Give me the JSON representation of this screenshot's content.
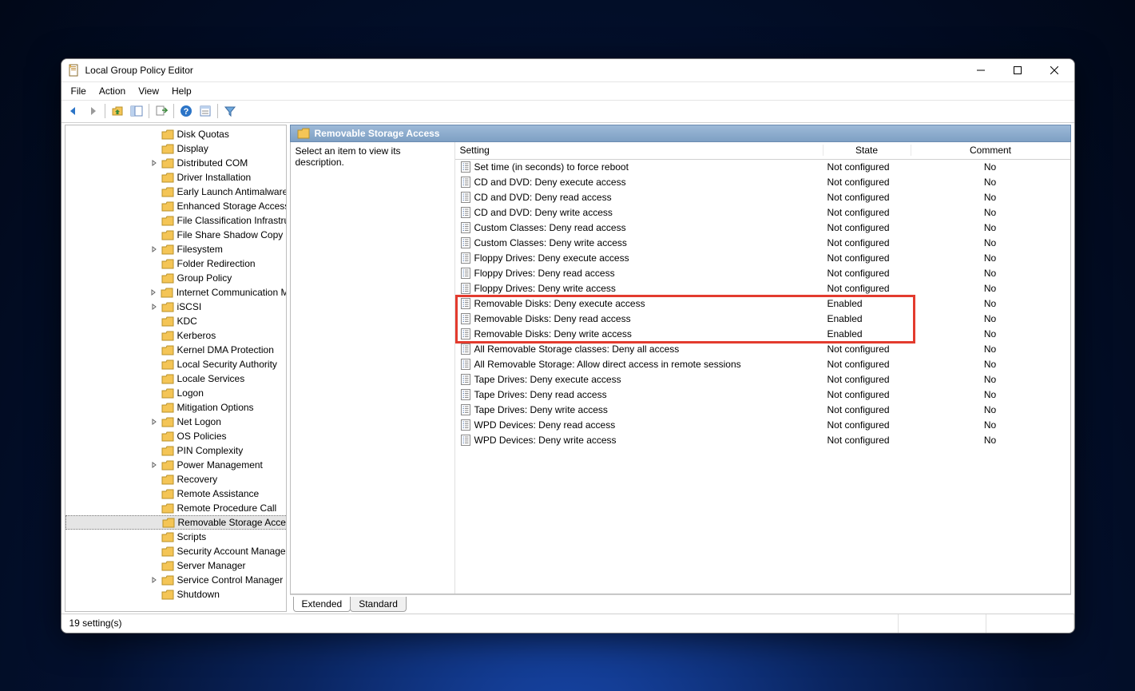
{
  "window": {
    "title": "Local Group Policy Editor"
  },
  "menubar": [
    "File",
    "Action",
    "View",
    "Help"
  ],
  "tree": [
    {
      "label": "Disk Quotas",
      "exp": ""
    },
    {
      "label": "Display",
      "exp": ""
    },
    {
      "label": "Distributed COM",
      "exp": ">"
    },
    {
      "label": "Driver Installation",
      "exp": ""
    },
    {
      "label": "Early Launch Antimalware",
      "exp": ""
    },
    {
      "label": "Enhanced Storage Access",
      "exp": ""
    },
    {
      "label": "File Classification Infrastructure",
      "exp": ""
    },
    {
      "label": "File Share Shadow Copy Provider",
      "exp": ""
    },
    {
      "label": "Filesystem",
      "exp": ">"
    },
    {
      "label": "Folder Redirection",
      "exp": ""
    },
    {
      "label": "Group Policy",
      "exp": ""
    },
    {
      "label": "Internet Communication Management",
      "exp": ">"
    },
    {
      "label": "iSCSI",
      "exp": ">"
    },
    {
      "label": "KDC",
      "exp": ""
    },
    {
      "label": "Kerberos",
      "exp": ""
    },
    {
      "label": "Kernel DMA Protection",
      "exp": ""
    },
    {
      "label": "Local Security Authority",
      "exp": ""
    },
    {
      "label": "Locale Services",
      "exp": ""
    },
    {
      "label": "Logon",
      "exp": ""
    },
    {
      "label": "Mitigation Options",
      "exp": ""
    },
    {
      "label": "Net Logon",
      "exp": ">"
    },
    {
      "label": "OS Policies",
      "exp": ""
    },
    {
      "label": "PIN Complexity",
      "exp": ""
    },
    {
      "label": "Power Management",
      "exp": ">"
    },
    {
      "label": "Recovery",
      "exp": ""
    },
    {
      "label": "Remote Assistance",
      "exp": ""
    },
    {
      "label": "Remote Procedure Call",
      "exp": ""
    },
    {
      "label": "Removable Storage Access",
      "exp": "",
      "selected": true
    },
    {
      "label": "Scripts",
      "exp": ""
    },
    {
      "label": "Security Account Manager",
      "exp": ""
    },
    {
      "label": "Server Manager",
      "exp": ""
    },
    {
      "label": "Service Control Manager Settings",
      "exp": ">"
    },
    {
      "label": "Shutdown",
      "exp": ""
    }
  ],
  "header": {
    "title": "Removable Storage Access"
  },
  "description": "Select an item to view its description.",
  "columns": {
    "setting": "Setting",
    "state": "State",
    "comment": "Comment"
  },
  "settings": [
    {
      "name": "Set time (in seconds) to force reboot",
      "state": "Not configured",
      "comment": "No"
    },
    {
      "name": "CD and DVD: Deny execute access",
      "state": "Not configured",
      "comment": "No"
    },
    {
      "name": "CD and DVD: Deny read access",
      "state": "Not configured",
      "comment": "No"
    },
    {
      "name": "CD and DVD: Deny write access",
      "state": "Not configured",
      "comment": "No"
    },
    {
      "name": "Custom Classes: Deny read access",
      "state": "Not configured",
      "comment": "No"
    },
    {
      "name": "Custom Classes: Deny write access",
      "state": "Not configured",
      "comment": "No"
    },
    {
      "name": "Floppy Drives: Deny execute access",
      "state": "Not configured",
      "comment": "No"
    },
    {
      "name": "Floppy Drives: Deny read access",
      "state": "Not configured",
      "comment": "No"
    },
    {
      "name": "Floppy Drives: Deny write access",
      "state": "Not configured",
      "comment": "No"
    },
    {
      "name": "Removable Disks: Deny execute access",
      "state": "Enabled",
      "comment": "No",
      "hl": true
    },
    {
      "name": "Removable Disks: Deny read access",
      "state": "Enabled",
      "comment": "No",
      "hl": true
    },
    {
      "name": "Removable Disks: Deny write access",
      "state": "Enabled",
      "comment": "No",
      "hl": true
    },
    {
      "name": "All Removable Storage classes: Deny all access",
      "state": "Not configured",
      "comment": "No"
    },
    {
      "name": "All Removable Storage: Allow direct access in remote sessions",
      "state": "Not configured",
      "comment": "No"
    },
    {
      "name": "Tape Drives: Deny execute access",
      "state": "Not configured",
      "comment": "No"
    },
    {
      "name": "Tape Drives: Deny read access",
      "state": "Not configured",
      "comment": "No"
    },
    {
      "name": "Tape Drives: Deny write access",
      "state": "Not configured",
      "comment": "No"
    },
    {
      "name": "WPD Devices: Deny read access",
      "state": "Not configured",
      "comment": "No"
    },
    {
      "name": "WPD Devices: Deny write access",
      "state": "Not configured",
      "comment": "No"
    }
  ],
  "tabs": {
    "extended": "Extended",
    "standard": "Standard"
  },
  "status": "19 setting(s)"
}
